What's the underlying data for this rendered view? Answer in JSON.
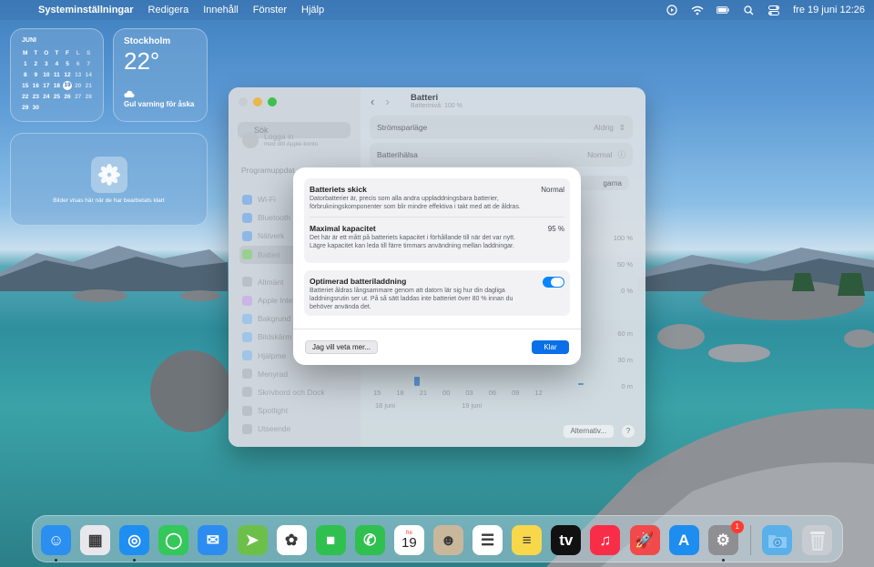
{
  "menubar": {
    "app_name": "Systeminställningar",
    "items": [
      "Redigera",
      "Innehåll",
      "Fönster",
      "Hjälp"
    ],
    "datetime": "fre 19 juni 12:26"
  },
  "widgets": {
    "calendar": {
      "month": "JUNI",
      "weekdays": [
        "M",
        "T",
        "O",
        "T",
        "F",
        "L",
        "S"
      ],
      "weeks": [
        [
          "1",
          "2",
          "3",
          "4",
          "5",
          "6",
          "7"
        ],
        [
          "8",
          "9",
          "10",
          "11",
          "12",
          "13",
          "14"
        ],
        [
          "15",
          "16",
          "17",
          "18",
          "19",
          "20",
          "21"
        ],
        [
          "22",
          "23",
          "24",
          "25",
          "26",
          "27",
          "28"
        ],
        [
          "29",
          "30",
          "",
          "",
          "",
          "",
          ""
        ]
      ],
      "today": "19"
    },
    "weather": {
      "city": "Stockholm",
      "temperature": "22°",
      "warning": "Gul varning för åska"
    },
    "photos": {
      "caption": "Bilder visas här när de har bearbetats klart"
    }
  },
  "settings_window": {
    "search_placeholder": "Sök",
    "login_title": "Logga in",
    "login_subtitle": "med ditt Apple-konto",
    "section_label": "Programuppdat",
    "sidebar": {
      "group1": [
        "Wi-Fi",
        "Bluetooth",
        "Nätverk",
        "Batteri"
      ],
      "group2": [
        "Allmänt",
        "Apple Intel",
        "Bakgrund",
        "Bildskärm",
        "Hjälpme",
        "Menyrad",
        "Skrivbord och Dock",
        "Spotlight",
        "Utseende"
      ],
      "selected": "Batteri"
    },
    "page_title": "Batteri",
    "page_subtitle": "Batterinivå: 100 %",
    "rows": [
      {
        "label": "Strömsparläge",
        "value": "Aldrig"
      },
      {
        "label": "Batterihälsa",
        "value": "Normal"
      }
    ],
    "partial_button": "garna",
    "level_axis": [
      "100 %",
      "50 %",
      "0 %"
    ],
    "time_axis": [
      "60 m",
      "30 m",
      "0 m"
    ],
    "x_ticks": [
      "15",
      "18",
      "21",
      "00",
      "03",
      "06",
      "09",
      "12"
    ],
    "date_labels": [
      "18 juni",
      "19 juni"
    ],
    "alt_button": "Alternativ...",
    "help_button": "?"
  },
  "battery_sheet": {
    "items": [
      {
        "title": "Batteriets skick",
        "value": "Normal",
        "description": "Datorbatterier är, precis som alla andra uppladdningsbara batterier, förbrukningskomponenter som blir mindre effektiva i takt med att de åldras."
      },
      {
        "title": "Maximal kapacitet",
        "value": "95 %",
        "description": "Det här är ett mått på batteriets kapacitet i förhållande till när det var nytt. Lägre kapacitet kan leda till färre timmars användning mellan laddningar."
      }
    ],
    "optimized": {
      "title": "Optimerad batteriladdning",
      "description": "Batteriet åldras långsammare genom att datorn lär sig hur din dagliga laddningsrutin ser ut. På så sätt laddas inte batteriet över 80 % innan du behöver använda det.",
      "enabled": true
    },
    "learn_more_button": "Jag vill veta mer...",
    "done_button": "Klar"
  },
  "dock": {
    "apps": [
      {
        "name": "Finder",
        "icon": "finder-icon",
        "color": "#2a8ff0",
        "glyph": "☺"
      },
      {
        "name": "Launchpad",
        "icon": "launchpad-icon",
        "color": "#e8e8ec",
        "glyph": "▦"
      },
      {
        "name": "Safari",
        "icon": "safari-icon",
        "color": "#1f8ef1",
        "glyph": "◎"
      },
      {
        "name": "Meddelanden",
        "icon": "messages-icon",
        "color": "#34c759",
        "glyph": "◯"
      },
      {
        "name": "Mail",
        "icon": "mail-icon",
        "color": "#2d8cf0",
        "glyph": "✉"
      },
      {
        "name": "Kartor",
        "icon": "maps-icon",
        "color": "#6cc04a",
        "glyph": "➤"
      },
      {
        "name": "Bilder",
        "icon": "photos-icon",
        "color": "#ffffff",
        "glyph": "✿"
      },
      {
        "name": "FaceTime",
        "icon": "facetime-icon",
        "color": "#30c04f",
        "glyph": "■"
      },
      {
        "name": "Telefon",
        "icon": "phone-icon",
        "color": "#30c04f",
        "glyph": "✆"
      },
      {
        "name": "Kalender",
        "icon": "calendar-icon",
        "color": "#ffffff",
        "glyph": "19",
        "label": "fre"
      },
      {
        "name": "Kontakter",
        "icon": "contacts-icon",
        "color": "#c9b79c",
        "glyph": "☻"
      },
      {
        "name": "Påminnelser",
        "icon": "reminders-icon",
        "color": "#ffffff",
        "glyph": "☰"
      },
      {
        "name": "Anteckningar",
        "icon": "notes-icon",
        "color": "#f8d84a",
        "glyph": "≡"
      },
      {
        "name": "TV",
        "icon": "tv-icon",
        "color": "#111111",
        "glyph": "tv"
      },
      {
        "name": "Musik",
        "icon": "music-icon",
        "color": "#fa2d48",
        "glyph": "♫"
      },
      {
        "name": "Launchpad Rocket",
        "icon": "rocket-icon",
        "color": "#f04a4a",
        "glyph": "🚀"
      },
      {
        "name": "App Store",
        "icon": "appstore-icon",
        "color": "#1d8df0",
        "glyph": "A"
      },
      {
        "name": "Systeminställningar",
        "icon": "gear-icon",
        "color": "#8e8e93",
        "glyph": "⚙",
        "badge": "1"
      }
    ],
    "downloads": {
      "icon": "downloads-folder-icon",
      "color": "#5ab0e8"
    },
    "trash": {
      "icon": "trash-icon",
      "color": "#c8ccd0"
    }
  }
}
